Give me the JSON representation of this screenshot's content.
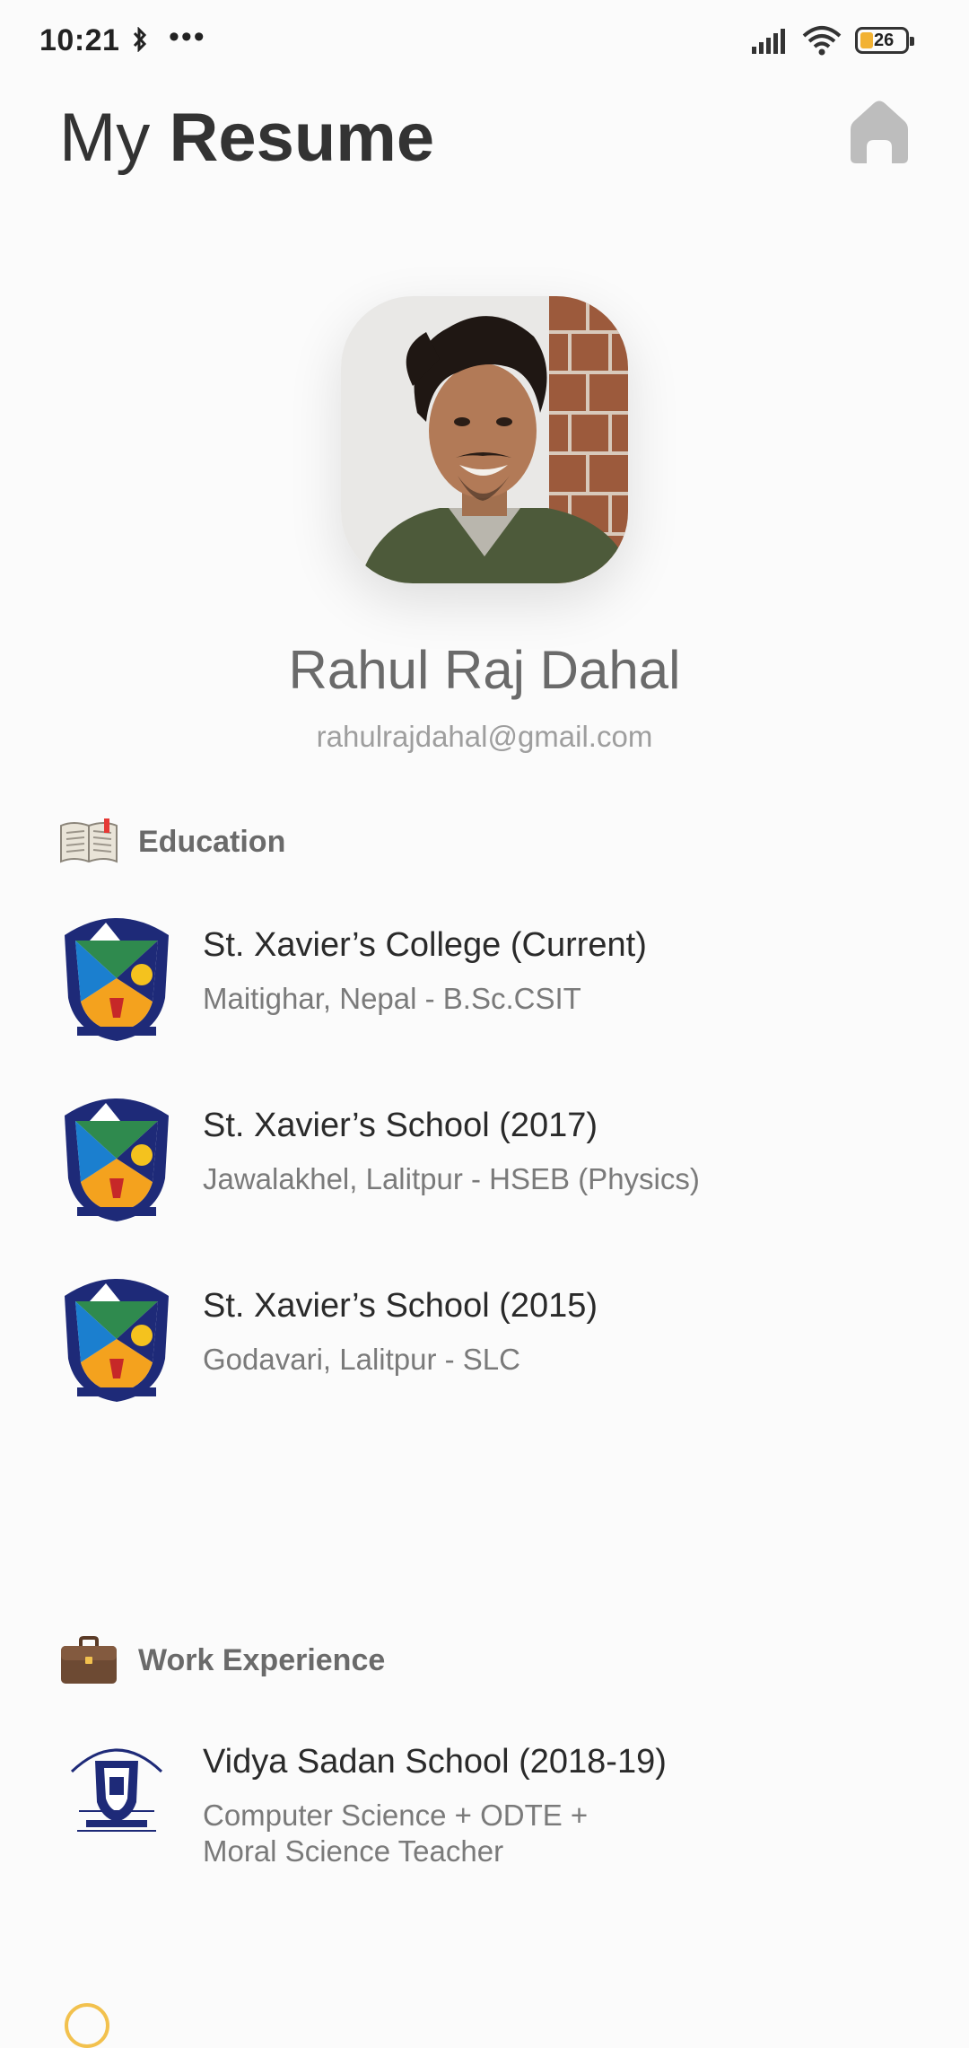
{
  "status_bar": {
    "time": "10:21",
    "dots": "•••",
    "battery": "26",
    "icons": [
      "bluetooth-icon",
      "signal-icon",
      "wifi-icon",
      "battery-icon"
    ]
  },
  "header": {
    "title_light": "My",
    "title_bold": "Resume",
    "home_icon": "home-icon"
  },
  "profile": {
    "name": "Rahul Raj Dahal",
    "email": "rahulrajdahal@gmail.com"
  },
  "education": {
    "label": "Education",
    "icon": "open-book-icon",
    "items": [
      {
        "title": "St. Xavier’s College (Current)",
        "subtitle": "Maitighar, Nepal - B.Sc.CSIT"
      },
      {
        "title": "St. Xavier’s School (2017)",
        "subtitle": "Jawalakhel, Lalitpur - HSEB (Physics)"
      },
      {
        "title": "St. Xavier’s School (2015)",
        "subtitle": "Godavari, Lalitpur - SLC"
      }
    ]
  },
  "work": {
    "label": "Work Experience",
    "icon": "briefcase-icon",
    "items": [
      {
        "title": "Vidya Sadan School (2018-19)",
        "subtitle_line1": "Computer Science + ODTE +",
        "subtitle_line2": "Moral Science Teacher"
      }
    ]
  },
  "colors": {
    "background": "#fbfbfb",
    "title": "#333333",
    "muted": "#6a6a6a",
    "subtle": "#9e9e9e",
    "home_icon": "#bdbdbd",
    "battery_fill": "#f2b233"
  }
}
